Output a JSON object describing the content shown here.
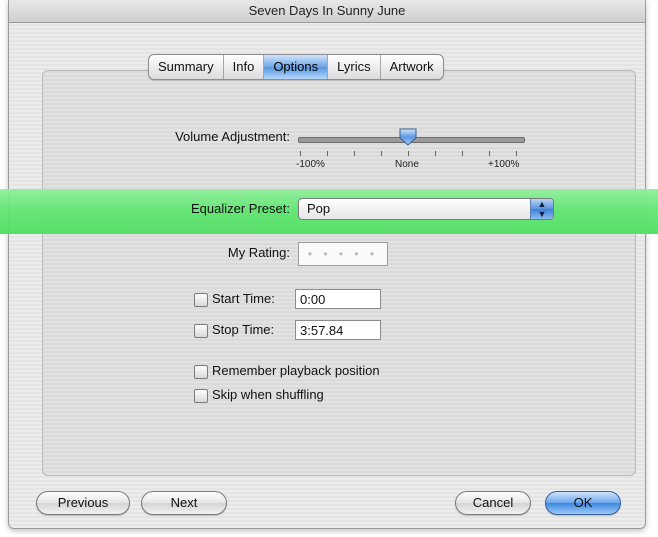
{
  "window": {
    "title": "Seven Days In Sunny June"
  },
  "tabs": [
    {
      "label": "Summary",
      "selected": false
    },
    {
      "label": "Info",
      "selected": false
    },
    {
      "label": "Options",
      "selected": true
    },
    {
      "label": "Lyrics",
      "selected": false
    },
    {
      "label": "Artwork",
      "selected": false
    }
  ],
  "volume": {
    "label": "Volume Adjustment:",
    "min_label": "-100%",
    "mid_label": "None",
    "max_label": "+100%",
    "value_fraction": 0.5
  },
  "equalizer": {
    "label": "Equalizer Preset:",
    "value": "Pop"
  },
  "rating": {
    "label": "My Rating:",
    "placeholder": "• • • • •"
  },
  "start_time": {
    "label": "Start Time:",
    "value": "0:00",
    "checked": false
  },
  "stop_time": {
    "label": "Stop Time:",
    "value": "3:57.84",
    "checked": false
  },
  "options": {
    "remember_playback": "Remember playback position",
    "skip_shuffling": "Skip when shuffling"
  },
  "buttons": {
    "previous": "Previous",
    "next": "Next",
    "cancel": "Cancel",
    "ok": "OK"
  },
  "colors": {
    "highlight": "#5ee56f",
    "selected_tab": "#5896e0",
    "ok_button": "#3c86e0"
  }
}
